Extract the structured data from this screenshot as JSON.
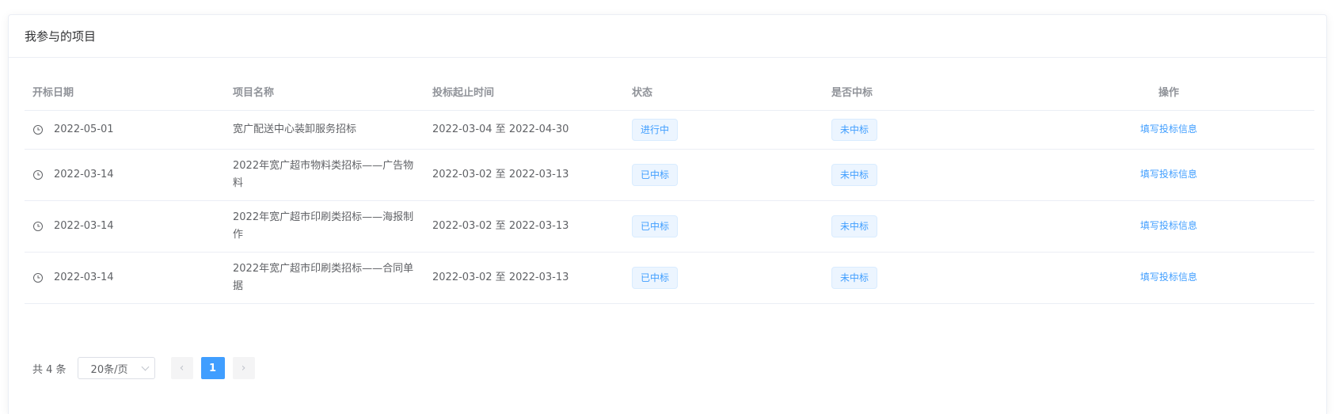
{
  "card": {
    "title": "我参与的项目"
  },
  "table": {
    "headers": [
      "开标日期",
      "项目名称",
      "投标起止时间",
      "状态",
      "是否中标",
      "操作"
    ],
    "rows": [
      {
        "date": "2022-05-01",
        "name": "宽广配送中心装卸服务招标",
        "period": "2022-03-04 至 2022-04-30",
        "status": "进行中",
        "won": "未中标",
        "action": "填写投标信息"
      },
      {
        "date": "2022-03-14",
        "name": "2022年宽广超市物料类招标——广告物料",
        "period": "2022-03-02 至 2022-03-13",
        "status": "已中标",
        "won": "未中标",
        "action": "填写投标信息"
      },
      {
        "date": "2022-03-14",
        "name": "2022年宽广超市印刷类招标——海报制作",
        "period": "2022-03-02 至 2022-03-13",
        "status": "已中标",
        "won": "未中标",
        "action": "填写投标信息"
      },
      {
        "date": "2022-03-14",
        "name": "2022年宽广超市印刷类招标——合同单据",
        "period": "2022-03-02 至 2022-03-13",
        "status": "已中标",
        "won": "未中标",
        "action": "填写投标信息"
      }
    ]
  },
  "pagination": {
    "total": "共 4 条",
    "page_size": "20条/页",
    "prev": "‹",
    "current": "1",
    "next": "›"
  },
  "colors": {
    "accent": "#409eff",
    "tag_bg": "#ecf5ff"
  },
  "icons": {
    "date": "clock-icon",
    "select": "chevron-down-icon"
  }
}
